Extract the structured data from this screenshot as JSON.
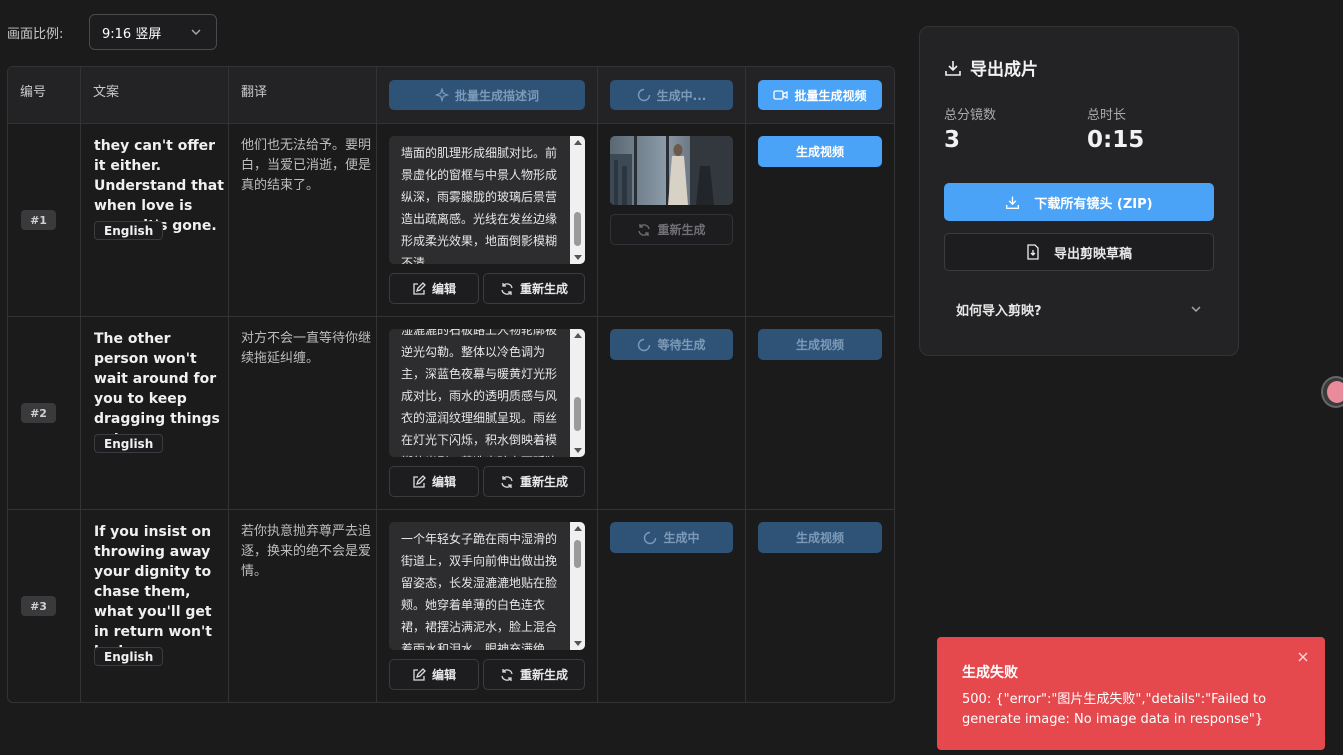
{
  "toolbar": {
    "ratio_label": "画面比例:",
    "ratio_value": "9:16 竖屏"
  },
  "table": {
    "headers": {
      "num": "编号",
      "copy": "文案",
      "translation": "翻译"
    },
    "header_buttons": {
      "batch_desc": "批量生成描述词",
      "generating": "生成中...",
      "batch_video": "批量生成视频"
    },
    "rows": [
      {
        "num": "#1",
        "en": "they can't offer it either. Understand that when love is gone, it's gone.",
        "lang": "English",
        "zh": "他们也无法给予。要明白，当爱已消逝，便是真的结束了。",
        "desc": "墙面的肌理形成细腻对比。前景虚化的窗框与中景人物形成纵深，雨雾朦胧的玻璃后景营造出疏离感。光线在发丝边缘形成柔光效果，地面倒影模糊不清。",
        "edit": "编辑",
        "regen": "重新生成",
        "image_action": "重新生成",
        "video_action": "生成视频"
      },
      {
        "num": "#2",
        "en": "The other person won't wait around for you to keep dragging things out.",
        "lang": "English",
        "zh": "对方不会一直等待你继续拖延纠缠。",
        "desc": "湿漉漉的石板路上人物轮廓被逆光勾勒。整体以冷色调为主，深蓝色夜幕与暖黄灯光形成对比，雨水的透明质感与风衣的湿润纹理细腻呈现。雨丝在灯光下闪烁，积水倒映着模糊的光影，营造出疏离而孤独的氛围。",
        "edit": "编辑",
        "regen": "重新生成",
        "image_action": "等待生成",
        "video_action": "生成视频"
      },
      {
        "num": "#3",
        "en": "If you insist on throwing away your dignity to chase them, what you'll get in return won't be love.",
        "lang": "English",
        "zh": "若你执意抛弃尊严去追逐，换来的绝不会是爱情。",
        "desc": "一个年轻女子跪在雨中湿滑的街道上，双手向前伸出做出挽留姿态，长发湿漉漉地贴在脸颊。她穿着单薄的白色连衣裙，裙摆沾满泥水，脸上混合着雨水和泪水，眼神充满绝望。",
        "edit": "编辑",
        "regen": "重新生成",
        "image_action": "生成中",
        "video_action": "生成视频"
      }
    ]
  },
  "export": {
    "title": "导出成片",
    "total_shots_label": "总分镜数",
    "total_shots": "3",
    "duration_label": "总时长",
    "duration": "0:15",
    "download_all": "下载所有镜头 (ZIP)",
    "export_draft": "导出剪映草稿",
    "how_import": "如何导入剪映?"
  },
  "toast": {
    "title": "生成失败",
    "message": "500: {\"error\":\"图片生成失败\",\"details\":\"Failed to generate image: No image data in response\"}"
  },
  "colors": {
    "accent": "#4aa3f7",
    "error": "#e5484d",
    "background": "#1b1b1c",
    "panel": "#232325"
  }
}
